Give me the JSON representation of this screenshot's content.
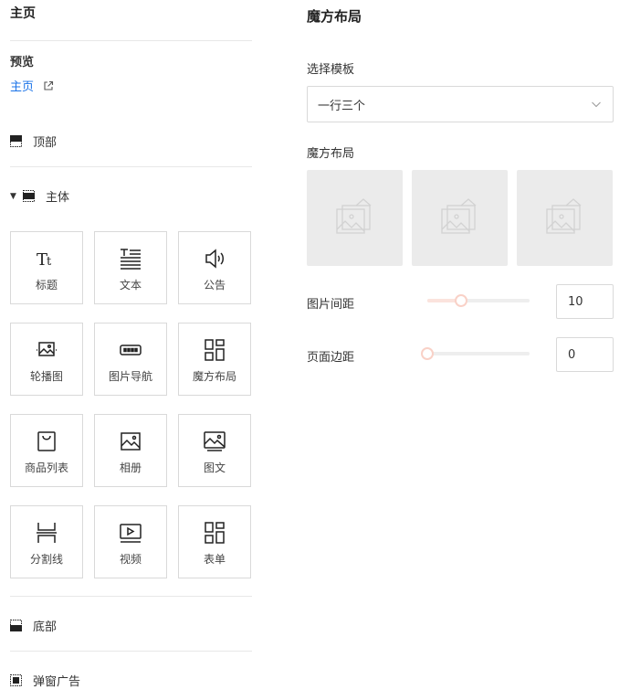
{
  "left": {
    "title": "主页",
    "preview": {
      "label": "预览",
      "link_text": "主页"
    },
    "sections": {
      "top": "顶部",
      "body": "主体",
      "bottom": "底部",
      "popup": "弹窗广告"
    },
    "tiles": [
      {
        "label": "标题",
        "icon": "title-icon"
      },
      {
        "label": "文本",
        "icon": "text-icon"
      },
      {
        "label": "公告",
        "icon": "notice-icon"
      },
      {
        "label": "轮播图",
        "icon": "carousel-icon"
      },
      {
        "label": "图片导航",
        "icon": "image-nav-icon"
      },
      {
        "label": "魔方布局",
        "icon": "cube-layout-icon"
      },
      {
        "label": "商品列表",
        "icon": "product-list-icon"
      },
      {
        "label": "相册",
        "icon": "album-icon"
      },
      {
        "label": "图文",
        "icon": "image-text-icon"
      },
      {
        "label": "分割线",
        "icon": "divider-icon"
      },
      {
        "label": "视频",
        "icon": "video-icon"
      },
      {
        "label": "表单",
        "icon": "form-icon"
      }
    ]
  },
  "right": {
    "title": "魔方布局",
    "template_label": "选择模板",
    "template_value": "一行三个",
    "layout_label": "魔方布局",
    "image_spacing": {
      "label": "图片间距",
      "value": "10",
      "fraction": 0.33
    },
    "page_margin": {
      "label": "页面边距",
      "value": "0",
      "fraction": 0
    }
  },
  "colors": {
    "link": "#1a73e8",
    "slider_accent": "#f9d1c7",
    "placeholder_bg": "#ebebeb"
  }
}
